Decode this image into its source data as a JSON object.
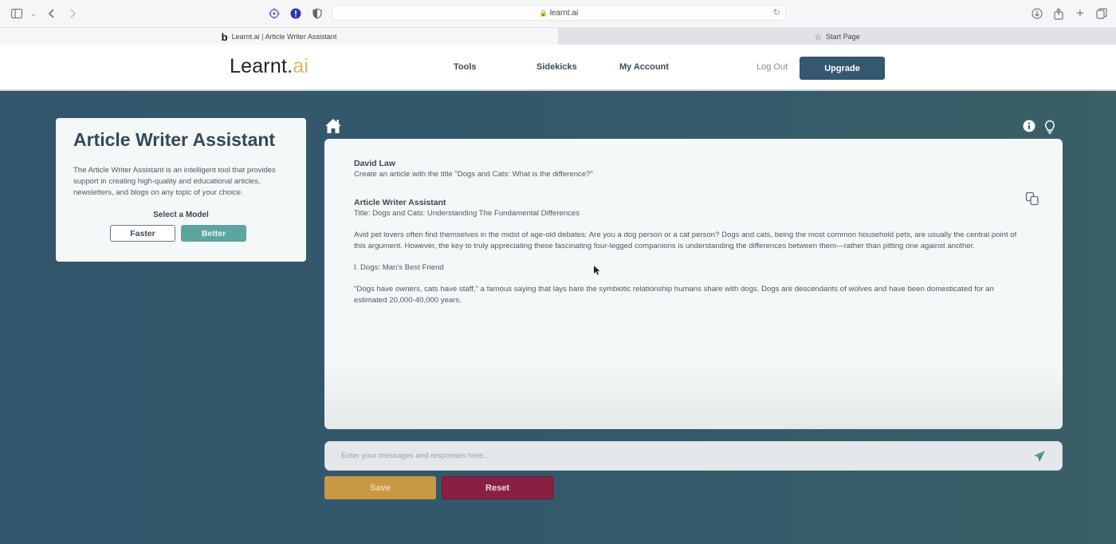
{
  "browser": {
    "url": "learnt.ai",
    "tabs": [
      {
        "label": "Learnt.ai | Article Writer Assistant",
        "favicon": "b",
        "active": true
      },
      {
        "label": "Start Page",
        "active": false
      }
    ],
    "toolbar_icons": [
      "sidebar-toggle-icon",
      "chevron-down-icon",
      "back-icon",
      "forward-icon",
      "extension-crosshair-icon",
      "extension-alert-icon",
      "privacy-shield-icon",
      "lock-icon",
      "reload-icon",
      "download-icon",
      "share-icon",
      "new-tab-icon",
      "tab-overview-icon"
    ]
  },
  "header": {
    "logo_main": "Learnt.",
    "logo_accent": "ai",
    "nav": [
      {
        "label": "Tools"
      },
      {
        "label": "Sidekicks"
      },
      {
        "label": "My Account"
      }
    ],
    "logout_label": "Log Out",
    "upgrade_label": "Upgrade"
  },
  "info_card": {
    "title": "Article Writer Assistant",
    "description": "The Article Writer Assistant is an intelligent tool that provides support in creating high-quality and educational articles, newsletters, and blogs on any topic of your choice.",
    "model_label": "Select a Model",
    "models": [
      {
        "label": "Faster",
        "selected": false
      },
      {
        "label": "Better",
        "selected": true
      }
    ]
  },
  "chat": {
    "messages": [
      {
        "author": "David Law",
        "lines": [
          "Create an article with the title \"Dogs and Cats: What is the difference?\""
        ]
      },
      {
        "author": "Article Writer Assistant",
        "title_line": "Title: Dogs and Cats: Understanding The Fundamental Differences",
        "paragraphs": [
          "Avid pet lovers often find themselves in the midst of age-old debates: Are you a dog person or a cat person? Dogs and cats, being the most common household pets, are usually the central point of this argument. However, the key to truly appreciating these fascinating four-legged companions is understanding the differences between them—rather than pitting one against another.",
          "I. Dogs: Man's Best Friend",
          "\"Dogs have owners, cats have staff,\" a famous saying that lays bare the symbiotic relationship humans share with dogs. Dogs are descendants of wolves and have been domesticated for an estimated 20,000-40,000 years."
        ]
      }
    ],
    "input_placeholder": "Enter your messages and responses here...",
    "input_value": ""
  },
  "actions": {
    "save_label": "Save",
    "reset_label": "Reset"
  },
  "colors": {
    "background": "#31556a",
    "upgrade": "#34586f",
    "better_selected": "#5fa59f",
    "save": "#c99843",
    "reset": "#8b1f42",
    "logo_accent": "#e3b35f"
  }
}
